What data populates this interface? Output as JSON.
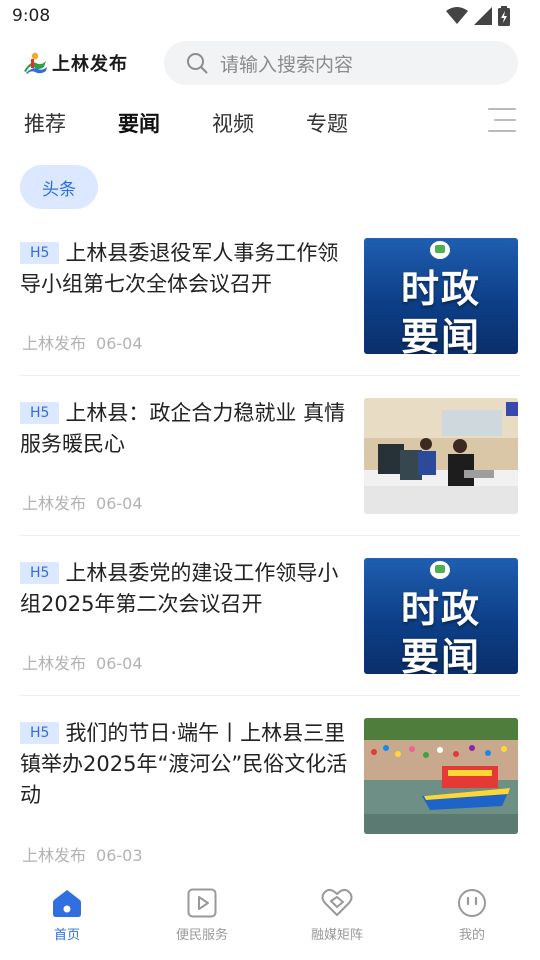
{
  "status_bar": {
    "time": "9:08"
  },
  "app": {
    "logo_text": "上林发布",
    "brand_color": "#2f6fe0"
  },
  "search": {
    "placeholder": "请输入搜索内容"
  },
  "tabs": [
    {
      "label": "推荐",
      "active": false
    },
    {
      "label": "要闻",
      "active": true
    },
    {
      "label": "视频",
      "active": false
    },
    {
      "label": "专题",
      "active": false
    }
  ],
  "chip": {
    "label": "头条"
  },
  "news": [
    {
      "badge": "H5",
      "title": "上林县委退役军人事务工作领导小组第七次全体会议召开",
      "source": "上林发布",
      "date": "06-04",
      "thumb_text": [
        "时政",
        "要闻"
      ]
    },
    {
      "badge": "H5",
      "title": "上林县：政企合力稳就业 真情服务暖民心",
      "source": "上林发布",
      "date": "06-04",
      "thumb": "office-photo"
    },
    {
      "badge": "H5",
      "title": "上林县委党的建设工作领导小组2025年第二次会议召开",
      "source": "上林发布",
      "date": "06-04",
      "thumb_text": [
        "时政",
        "要闻"
      ]
    },
    {
      "badge": "H5",
      "title": "我们的节日·端午丨上林县三里镇举办2025年“渡河公”民俗文化活动",
      "source": "上林发布",
      "date": "06-03",
      "thumb": "festival-photo"
    }
  ],
  "bottom_nav": [
    {
      "label": "首页",
      "icon": "home-icon",
      "active": true
    },
    {
      "label": "便民服务",
      "icon": "play-square-icon",
      "active": false
    },
    {
      "label": "融媒矩阵",
      "icon": "heart-link-icon",
      "active": false
    },
    {
      "label": "我的",
      "icon": "smiley-icon",
      "active": false
    }
  ]
}
